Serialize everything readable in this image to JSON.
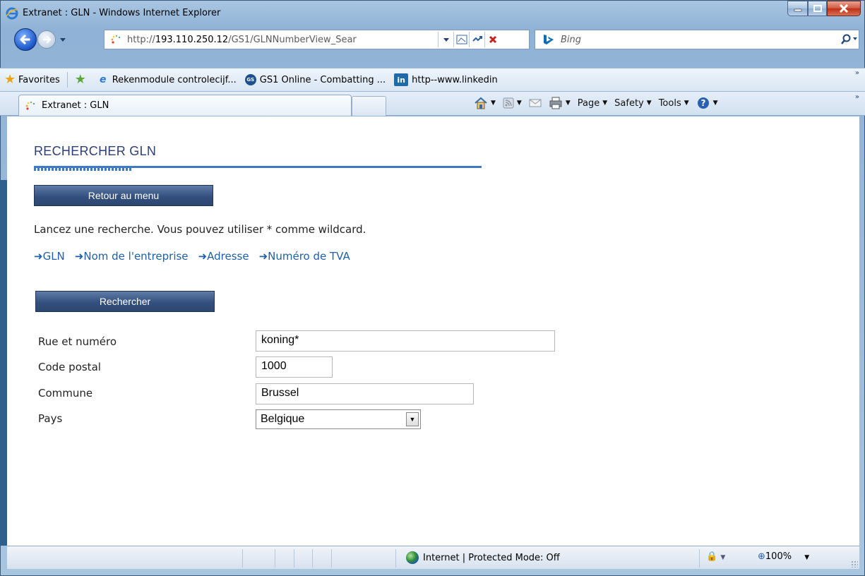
{
  "window": {
    "title": "Extranet : GLN - Windows Internet Explorer"
  },
  "address_bar": {
    "url_prefix": "http://",
    "url_host": "193.110.250.12",
    "url_path": "/GS1/GLNNumberView_Sear"
  },
  "search_box": {
    "placeholder": "Bing"
  },
  "favorites_bar": {
    "favorites_label": "Favorites",
    "items": [
      {
        "label": "Rekenmodule controlecijf...",
        "icon": "ie-page-icon"
      },
      {
        "label": "GS1 Online - Combatting ...",
        "icon": "gs1-icon"
      },
      {
        "label": "http--www.linkedin",
        "icon": "linkedin-icon"
      }
    ]
  },
  "tabs": [
    {
      "label": "Extranet : GLN",
      "active": true
    }
  ],
  "command_bar": {
    "page": "Page",
    "safety": "Safety",
    "tools": "Tools"
  },
  "page": {
    "title": "RECHERCHER GLN",
    "back_button": "Retour au menu",
    "intro": "Lancez une recherche. Vous pouvez utiliser * comme wildcard.",
    "search_links": [
      {
        "label": "GLN"
      },
      {
        "label": "Nom de l'entreprise"
      },
      {
        "label": "Adresse"
      },
      {
        "label": "Numéro de TVA"
      }
    ],
    "search_button": "Rechercher",
    "form": {
      "street_label": "Rue et numéro",
      "street_value": "koning*",
      "postal_label": "Code postal",
      "postal_value": "1000",
      "city_label": "Commune",
      "city_value": "Brussel",
      "country_label": "Pays",
      "country_value": "Belgique"
    }
  },
  "status_bar": {
    "zone": "Internet | Protected Mode: Off",
    "zoom": "100%"
  },
  "colors": {
    "accent_blue": "#3f7ac4",
    "title_color": "#2d3f78",
    "button_bg": "#34507e",
    "link_color": "#1f5fa5"
  }
}
